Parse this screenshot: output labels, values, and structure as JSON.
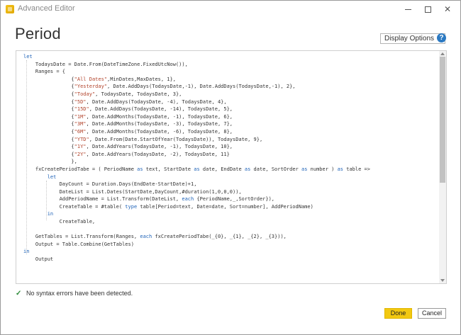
{
  "window": {
    "title": "Advanced Editor"
  },
  "header": {
    "title": "Period",
    "display_options_label": "Display Options",
    "help_glyph": "?"
  },
  "editor": {
    "lines": [
      [
        {
          "t": "let",
          "k": "kw"
        }
      ],
      [
        {
          "t": "    TodaysDate = Date.From(DateTimeZone.FixedUtcNow()),"
        }
      ],
      [
        {
          "t": "    Ranges = {"
        }
      ],
      [
        {
          "t": "                {"
        },
        {
          "t": "\"All Dates\"",
          "k": "str"
        },
        {
          "t": ",MinDates,MaxDates, 1},"
        }
      ],
      [
        {
          "t": "                {"
        },
        {
          "t": "\"Yesterday\"",
          "k": "str"
        },
        {
          "t": ", Date.AddDays(TodaysDate,-1), Date.AddDays(TodaysDate,-1), 2},"
        }
      ],
      [
        {
          "t": "                {"
        },
        {
          "t": "\"Today\"",
          "k": "str"
        },
        {
          "t": ", TodaysDate, TodaysDate, 3},"
        }
      ],
      [
        {
          "t": "                {"
        },
        {
          "t": "\"5D\"",
          "k": "str"
        },
        {
          "t": ", Date.AddDays(TodaysDate, -4), TodaysDate, 4},"
        }
      ],
      [
        {
          "t": "                {"
        },
        {
          "t": "\"15D\"",
          "k": "str"
        },
        {
          "t": ", Date.AddDays(TodaysDate, -14), TodaysDate, 5},"
        }
      ],
      [
        {
          "t": "                {"
        },
        {
          "t": "\"1M\"",
          "k": "str"
        },
        {
          "t": ", Date.AddMonths(TodaysDate, -1), TodaysDate, 6},"
        }
      ],
      [
        {
          "t": "                {"
        },
        {
          "t": "\"3M\"",
          "k": "str"
        },
        {
          "t": ", Date.AddMonths(TodaysDate, -3), TodaysDate, 7},"
        }
      ],
      [
        {
          "t": "                {"
        },
        {
          "t": "\"6M\"",
          "k": "str"
        },
        {
          "t": ", Date.AddMonths(TodaysDate, -6), TodaysDate, 8},"
        }
      ],
      [
        {
          "t": "                {"
        },
        {
          "t": "\"YTD\"",
          "k": "str"
        },
        {
          "t": ", Date.From(Date.StartOfYear(TodaysDate)), TodaysDate, 9},"
        }
      ],
      [
        {
          "t": "                {"
        },
        {
          "t": "\"1Y\"",
          "k": "str"
        },
        {
          "t": ", Date.AddYears(TodaysDate, -1), TodaysDate, 10},"
        }
      ],
      [
        {
          "t": "                {"
        },
        {
          "t": "\"2Y\"",
          "k": "str"
        },
        {
          "t": ", Date.AddYears(TodaysDate, -2), TodaysDate, 11}"
        }
      ],
      [
        {
          "t": "                },"
        }
      ],
      [
        {
          "t": "    fxCreatePeriodTabe = ( PeriodName "
        },
        {
          "t": "as",
          "k": "kw"
        },
        {
          "t": " text, StartDate "
        },
        {
          "t": "as",
          "k": "kw"
        },
        {
          "t": " date, EndDate "
        },
        {
          "t": "as",
          "k": "kw"
        },
        {
          "t": " date, SortOrder "
        },
        {
          "t": "as",
          "k": "kw"
        },
        {
          "t": " number ) "
        },
        {
          "t": "as",
          "k": "kw"
        },
        {
          "t": " table =>"
        }
      ],
      [
        {
          "t": "        "
        },
        {
          "t": "let",
          "k": "kw"
        }
      ],
      [
        {
          "t": "            DayCount = Duration.Days(EndDate-StartDate)+1,"
        }
      ],
      [
        {
          "t": "            DateList = List.Dates(StartDate,DayCount,#duration(1,0,0,0)),"
        }
      ],
      [
        {
          "t": "            AddPeriodName = List.Transform(DateList, "
        },
        {
          "t": "each",
          "k": "kw"
        },
        {
          "t": " {PeriodName,_,SortOrder}),"
        }
      ],
      [
        {
          "t": "            CreateTable = #table( "
        },
        {
          "t": "type",
          "k": "kw"
        },
        {
          "t": " table[Period=text, Date=date, Sort=number], AddPeriodName)"
        }
      ],
      [
        {
          "t": "        "
        },
        {
          "t": "in",
          "k": "kw"
        }
      ],
      [
        {
          "t": "            CreateTable,"
        }
      ],
      [
        {
          "t": ""
        }
      ],
      [
        {
          "t": "    GetTables = List.Transform(Ranges, "
        },
        {
          "t": "each",
          "k": "kw"
        },
        {
          "t": " fxCreatePeriodTabe(_{0}, _{1}, _{2}, _{3})),"
        }
      ],
      [
        {
          "t": "    Output = Table.Combine(GetTables)"
        }
      ],
      [
        {
          "t": "in",
          "k": "kw"
        }
      ],
      [
        {
          "t": "    Output"
        }
      ]
    ]
  },
  "status": {
    "check_glyph": "✓",
    "message": "No syntax errors have been detected."
  },
  "footer": {
    "done_label": "Done",
    "cancel_label": "Cancel"
  },
  "colors": {
    "accent": "#f2c811",
    "keyword": "#1f63b8",
    "string": "#b2432b",
    "ok": "#2e8b3a",
    "help": "#2b79c2"
  }
}
